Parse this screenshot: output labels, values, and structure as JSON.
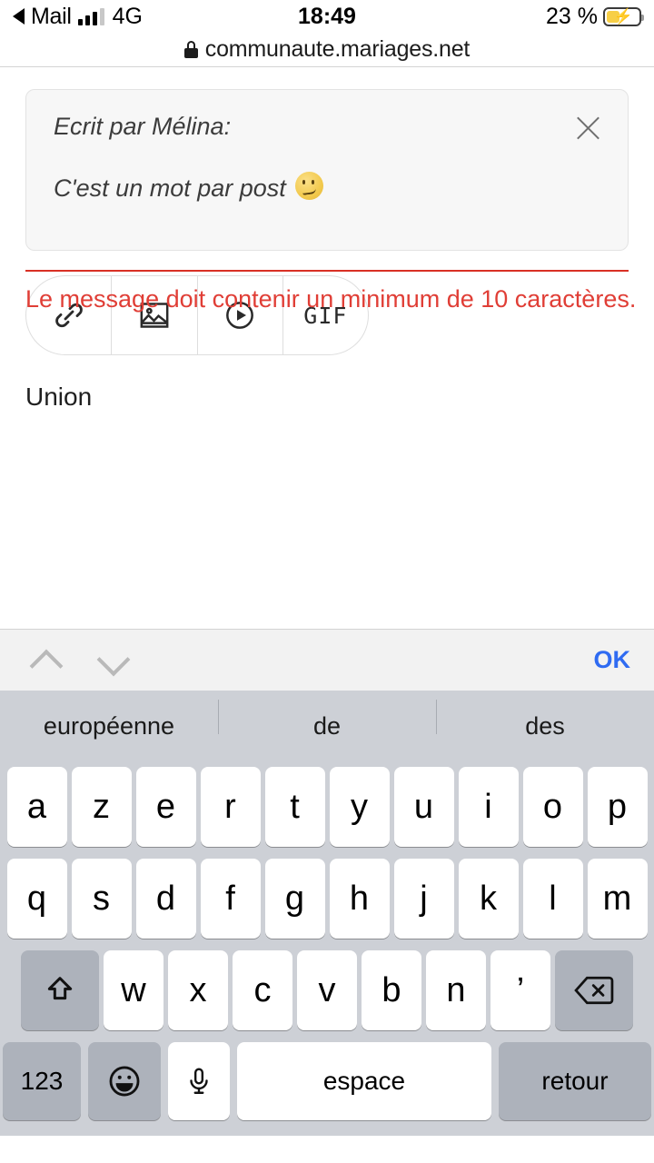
{
  "status_bar": {
    "back_label": "Mail",
    "back_icon": "triangle-left-icon",
    "signal_icon": "signal-bars-icon",
    "network": "4G",
    "time": "18:49",
    "battery_percent": "23 %",
    "battery_icon": "battery-charging-icon",
    "battery_level": 23,
    "battery_color": "#f7cf46"
  },
  "url_bar": {
    "lock_icon": "lock-icon",
    "url": "communaute.mariages.net"
  },
  "quote": {
    "author_line": "Ecrit par Mélina:",
    "body_line": "C'est un mot par post",
    "emoji": "smirking-face-emoji",
    "close_icon": "close-icon"
  },
  "media_toolbar": {
    "buttons": [
      {
        "name": "link-icon",
        "label": ""
      },
      {
        "name": "image-icon",
        "label": ""
      },
      {
        "name": "video-icon",
        "label": ""
      },
      {
        "name": "gif-button",
        "label": "GIF"
      }
    ]
  },
  "composer": {
    "message_value": "Union",
    "error_text": "Le message doit contenir un minimum de 10 caractères.",
    "error_color": "#e03e36",
    "rule_color": "#d93025"
  },
  "keyboard_accessory": {
    "prev_icon": "chevron-up-icon",
    "next_icon": "chevron-down-icon",
    "done_label": "OK",
    "done_color": "#2f6bf2"
  },
  "predictions": [
    "européenne",
    "de",
    "des"
  ],
  "keyboard": {
    "row1": [
      "a",
      "z",
      "e",
      "r",
      "t",
      "y",
      "u",
      "i",
      "o",
      "p"
    ],
    "row2": [
      "q",
      "s",
      "d",
      "f",
      "g",
      "h",
      "j",
      "k",
      "l",
      "m"
    ],
    "row3": [
      "w",
      "x",
      "c",
      "v",
      "b",
      "n",
      "’"
    ],
    "shift_icon": "shift-icon",
    "backspace_icon": "backspace-icon",
    "numbers_label": "123",
    "emoji_icon": "emoji-smiley-icon",
    "mic_icon": "microphone-icon",
    "space_label": "espace",
    "return_label": "retour"
  }
}
